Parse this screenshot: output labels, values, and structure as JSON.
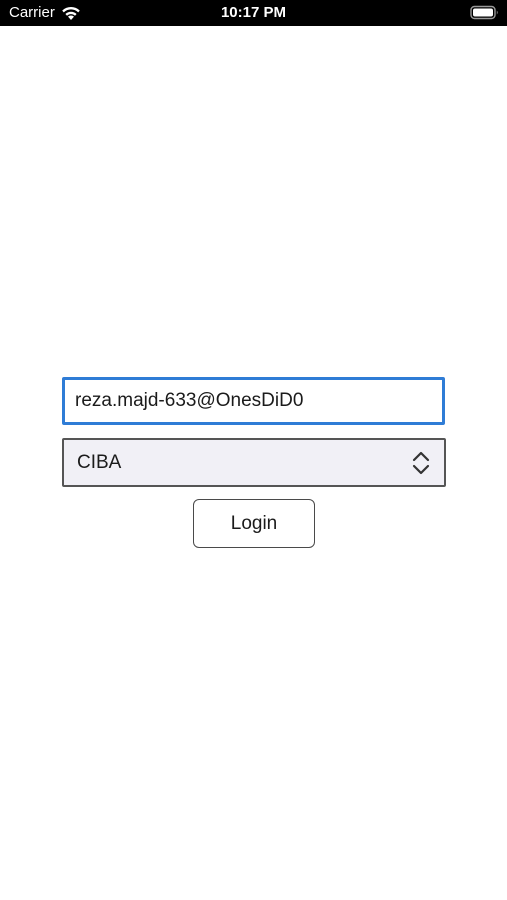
{
  "status_bar": {
    "carrier": "Carrier",
    "time": "10:17 PM",
    "wifi_icon": "wifi-icon",
    "battery_icon": "battery-icon"
  },
  "form": {
    "user_value": "reza.majd-633@OnesDiD0",
    "method_selected": "CIBA",
    "login_label": "Login",
    "focus_color": "#2f7cd6"
  }
}
